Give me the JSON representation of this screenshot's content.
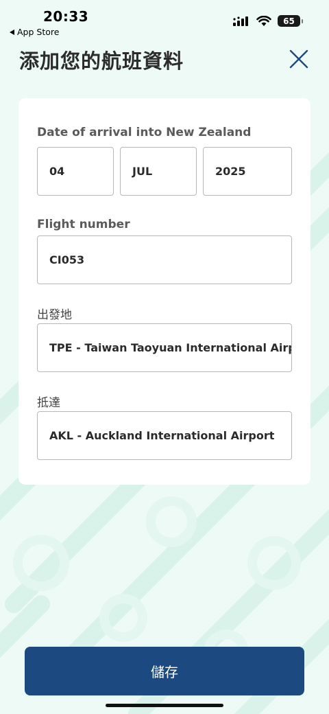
{
  "status_bar": {
    "time": "20:33",
    "back_label": "App Store",
    "battery_level": "65"
  },
  "header": {
    "title": "添加您的航班資料"
  },
  "form": {
    "arrival_date": {
      "label": "Date of arrival into New Zealand",
      "day": "04",
      "month": "JUL",
      "year": "2025"
    },
    "flight_number": {
      "label": "Flight number",
      "value": "CI053"
    },
    "origin": {
      "label": "出發地",
      "value": "TPE - Taiwan Taoyuan International Airport"
    },
    "destination": {
      "label": "抵達",
      "value": "AKL - Auckland International Airport"
    }
  },
  "actions": {
    "save_label": "儲存"
  },
  "colors": {
    "background": "#eefaf6",
    "pattern": "#d9f2ea",
    "primary_button": "#1c4a80",
    "close_icon": "#1c4a80"
  }
}
